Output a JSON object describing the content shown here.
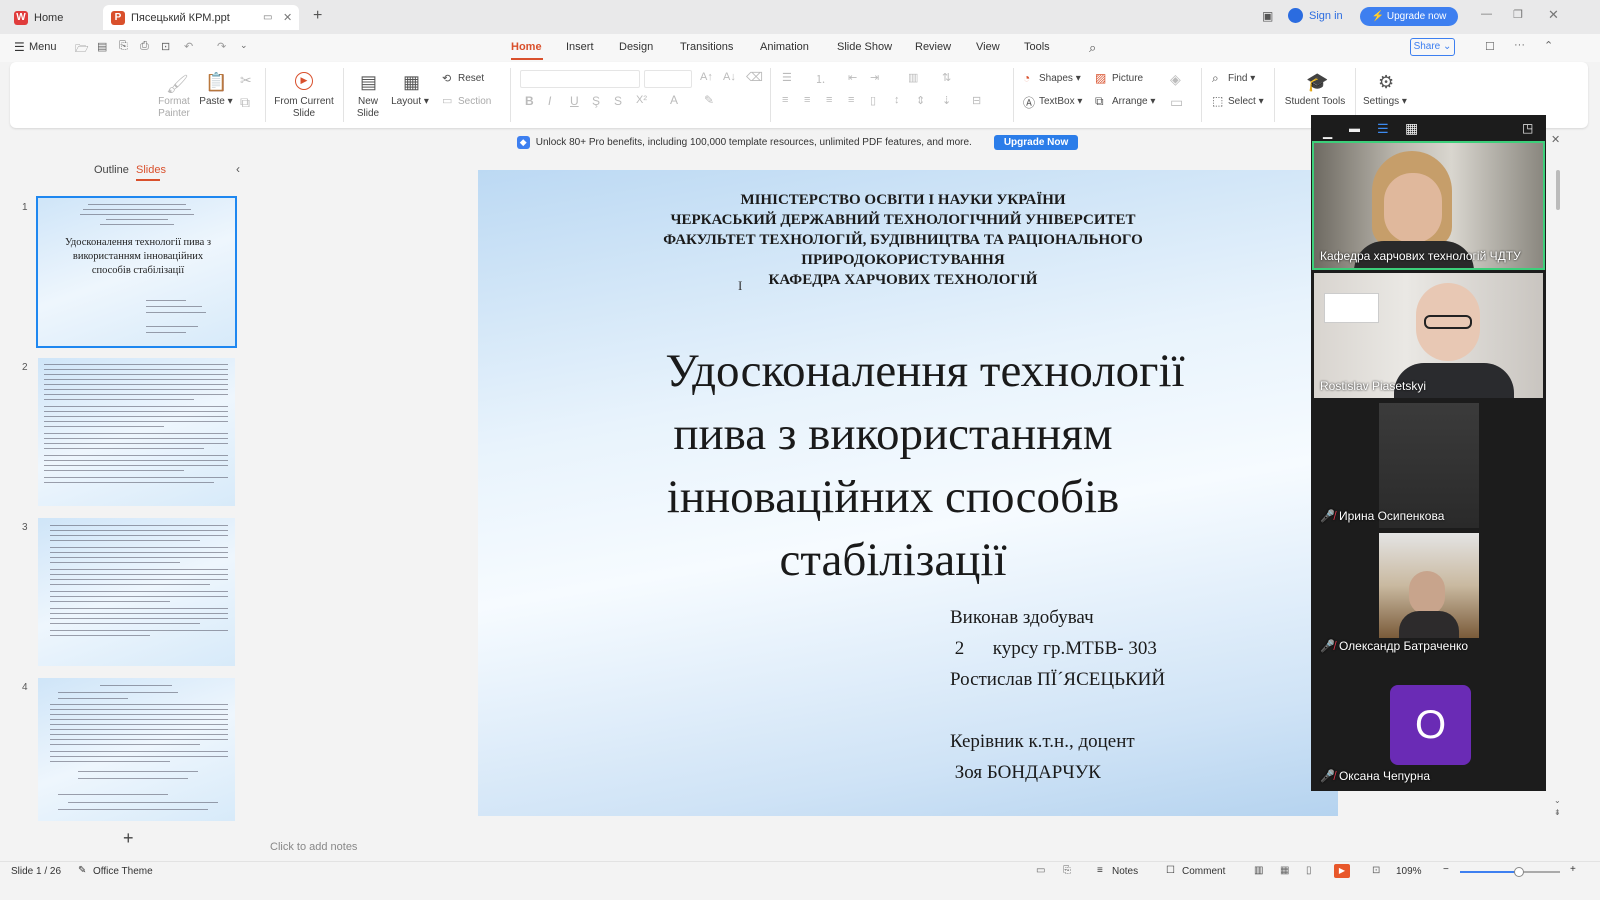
{
  "titlebar": {
    "home_tab": "Home",
    "doc_tab": "Пясецький КРМ.ppt",
    "sign_in": "Sign in",
    "upgrade_now": "Upgrade now"
  },
  "menubar": {
    "menu": "Menu",
    "tabs": [
      "Home",
      "Insert",
      "Design",
      "Transitions",
      "Animation",
      "Slide Show",
      "Review",
      "View",
      "Tools"
    ],
    "share": "Share"
  },
  "ribbon": {
    "format_painter": "Format Painter",
    "paste": "Paste",
    "from_current_slide": "From Current Slide",
    "new_slide": "New Slide",
    "layout": "Layout",
    "reset": "Reset",
    "section": "Section",
    "shapes": "Shapes",
    "picture": "Picture",
    "textbox": "TextBox",
    "arrange": "Arrange",
    "find": "Find",
    "select": "Select",
    "student_tools": "Student Tools",
    "settings": "Settings"
  },
  "banner": {
    "text": "Unlock 80+ Pro benefits, including 100,000 template resources, unlimited PDF features, and more.",
    "button": "Upgrade Now"
  },
  "left_panel": {
    "outline_tab": "Outline",
    "slides_tab": "Slides",
    "thumbnails": [
      {
        "number": "1"
      },
      {
        "number": "2"
      },
      {
        "number": "3"
      },
      {
        "number": "4"
      }
    ]
  },
  "slide": {
    "header_lines": [
      "МІНІСТЕРСТВО ОСВІТИ І НАУКИ УКРАЇНИ",
      "ЧЕРКАСЬКИЙ ДЕРЖАВНИЙ ТЕХНОЛОГІЧНИЙ УНІВЕРСИТЕТ",
      "ФАКУЛЬТЕТ ТЕХНОЛОГІЙ, БУДІВНИЦТВА ТА РАЦІОНАЛЬНОГО",
      "ПРИРОДОКОРИСТУВАННЯ",
      "КАФЕДРА ХАРЧОВИХ ТЕХНОЛОГІЙ"
    ],
    "title_lines": [
      "Удосконалення технології",
      "пива  з використанням",
      "інноваційних способів",
      "стабілізації"
    ],
    "author_lines": [
      "Виконав здобувач",
      " 2      курсу гр.МТБВ- 303",
      "Ростислав ПЇ´ЯСЕЦЬКИЙ"
    ],
    "supervisor_lines": [
      "Керівник к.т.н., доцент",
      " Зоя БОНДАРЧУК"
    ]
  },
  "notes_placeholder": "Click to add notes",
  "statusbar": {
    "slide_count": "Slide 1 / 26",
    "theme": "Office Theme",
    "notes": "Notes",
    "comment": "Comment",
    "zoom": "109%"
  },
  "video_call": {
    "participants": [
      {
        "name": "Кафедра харчових технологій ЧДТУ",
        "muted": false
      },
      {
        "name": "Rostislav Piasetskyi",
        "muted": false
      },
      {
        "name": "Ирина Осипенкова",
        "muted": true
      },
      {
        "name": "Олександр Батраченко",
        "muted": true
      },
      {
        "name": "Оксана Чепурна",
        "muted": true,
        "avatar_letter": "О"
      }
    ]
  },
  "colors": {
    "accent": "#d9502c",
    "upgrade_blue": "#2b7de9",
    "avatar_purple": "#6a2bb5"
  }
}
